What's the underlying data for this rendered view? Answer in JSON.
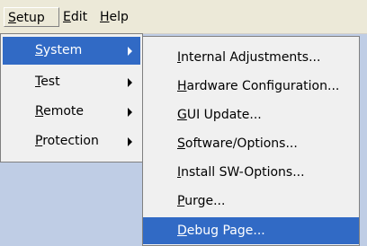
{
  "menubar": {
    "items": [
      {
        "label_ul": "S",
        "label_rest": "etup"
      },
      {
        "label_ul": "E",
        "label_rest": "dit"
      },
      {
        "label_ul": "H",
        "label_rest": "elp"
      }
    ]
  },
  "setup_menu": {
    "items": [
      {
        "label_ul": "S",
        "label_rest": "ystem"
      },
      {
        "label_ul": "T",
        "label_rest": "est"
      },
      {
        "label_ul": "R",
        "label_rest": "emote"
      },
      {
        "label_ul": "P",
        "label_rest": "rotection"
      }
    ]
  },
  "system_submenu": {
    "items": [
      {
        "label_ul": "I",
        "label_rest": "nternal Adjustments..."
      },
      {
        "label_ul": "H",
        "label_rest": "ardware Configuration..."
      },
      {
        "label_ul": "G",
        "label_rest": "UI Update..."
      },
      {
        "label_ul": "S",
        "label_rest": "oftware/Options..."
      },
      {
        "label_ul": "I",
        "label_rest": "nstall SW-Options..."
      },
      {
        "label_ul": "P",
        "label_rest": "urge..."
      },
      {
        "label_ul": "D",
        "label_rest": "ebug Page..."
      }
    ]
  },
  "colors": {
    "highlight": "#316ac5",
    "menu_background": "#f0f0f0",
    "background_area": "#bfcde5"
  }
}
